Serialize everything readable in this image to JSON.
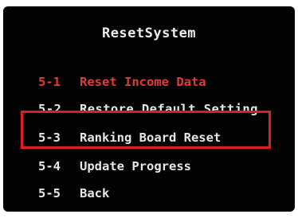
{
  "menu": {
    "title": "ResetSystem",
    "items": [
      {
        "number": "5-1",
        "label": "Reset Income Data"
      },
      {
        "number": "5-2",
        "label": "Restore Default Setting"
      },
      {
        "number": "5-3",
        "label": "Ranking Board Reset"
      },
      {
        "number": "5-4",
        "label": "Update Progress"
      },
      {
        "number": "5-5",
        "label": "Back"
      }
    ],
    "highlighted_item": "5-3"
  },
  "colors": {
    "background": "#030303",
    "text": "#e6e6e6",
    "item_red": "#e23a36",
    "highlight_border": "#e21d22"
  }
}
